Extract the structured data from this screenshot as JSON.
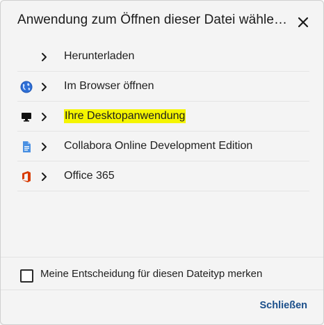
{
  "dialog": {
    "title": "Anwendung zum Öffnen dieser Datei wähle…",
    "close_icon": "close-icon"
  },
  "apps": [
    {
      "label": "Herunterladen",
      "icon": "none",
      "highlighted": false
    },
    {
      "label": "Im Browser öffnen",
      "icon": "globe-icon",
      "highlighted": false
    },
    {
      "label": "Ihre Desktopanwendung",
      "icon": "desktop-monitor-icon",
      "highlighted": true
    },
    {
      "label": "Collabora Online Development Edition",
      "icon": "document-icon",
      "highlighted": false
    },
    {
      "label": "Office 365",
      "icon": "office-logo-icon",
      "highlighted": false
    }
  ],
  "remember": {
    "label": "Meine Entscheidung für diesen Dateityp merken",
    "checked": false
  },
  "footer": {
    "close_label": "Schließen"
  },
  "colors": {
    "highlight": "#f5f500",
    "link": "#1a4e8a",
    "office_red": "#d83b01",
    "doc_blue": "#4a90e2",
    "globe_blue": "#2f6fd6"
  }
}
